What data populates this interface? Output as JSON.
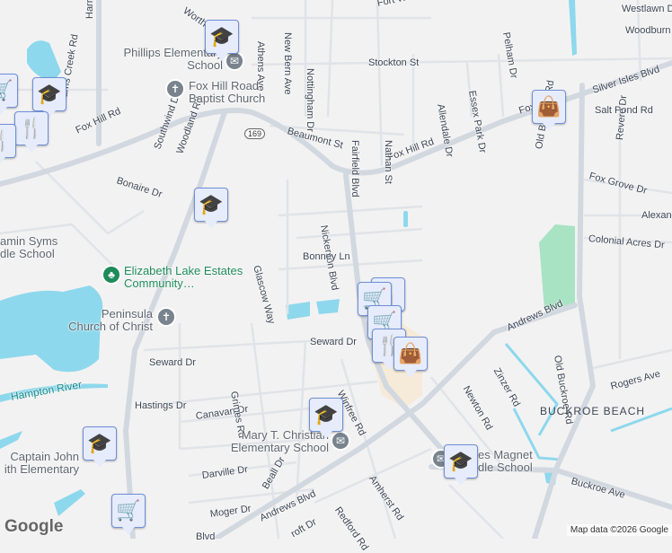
{
  "colors": {
    "background": "#f3f2f3",
    "road": "#d2d8df",
    "water": "#8dd8ec",
    "park": "#a8e3c4",
    "commercial": "#f6ead8",
    "pin_fill": "#e6ecfb",
    "pin_icon": "#0f4a6e"
  },
  "roads": {
    "fox_hill_rd": "Fox Hill Rd",
    "fox_hill_rd_2": "Fox Hill Rd",
    "fox_hill_rd_3": "Fox Hill Rd",
    "fox_hill_rd_4": "Fox Hill Rd",
    "silver_isles": "Silver Isles Blvd",
    "nickerson": "Nickerson Blvd",
    "andrews": "Andrews Blvd",
    "andrews_2": "Andrews Blvd",
    "andrews_3": "Blvd",
    "old_buckroe": "Old Buckroe Rd",
    "old_buckroe_2": "Old Buckroe Rd",
    "buckroe_ave": "Buckroe Ave",
    "woodland": "Woodland Rd",
    "harris_creek": "Harris Creek Rd",
    "harris_c": "Harris C",
    "southwind": "Southwind Dr",
    "bonaire": "Bonaire Dr",
    "beaumont": "Beaumont St",
    "stockton": "Stockton St",
    "athens": "Athens Ave",
    "new_bern": "New Bern Ave",
    "nottingham": "Nottingham Dr",
    "fort_worth": "Fort Worth",
    "worth": "Worth S",
    "fairfield": "Fairfield Blvd",
    "nathan": "Nathan St",
    "allendale": "Allendale Dr",
    "essex": "Essex Park Dr",
    "pelham": "Pelham Dr",
    "westlawn": "Westlawn D",
    "woodburn": "Woodburn",
    "salt_pond": "Salt Pond Rd",
    "revere": "Revere Dr",
    "fox_grove": "Fox Grove Dr",
    "alexan": "Alexan",
    "colonial": "Colonial Acres Dr",
    "glascow": "Glascow Way",
    "bonney": "Bonney Ln",
    "seward": "Seward Dr",
    "seward_2": "Seward Dr",
    "hastings": "Hastings Dr",
    "canavan": "Canavan Dr",
    "grimes": "Grimes Rd",
    "winfree": "Winfree Rd",
    "darville": "Darville Dr",
    "beall": "Beall Dr",
    "moger": "Moger Dr",
    "redford": "Redford Rd",
    "amherst": "Amherst Rd",
    "newton": "Newton Rd",
    "zinzer": "Zinzer Rd",
    "rogers": "Rogers Ave",
    "croft": "roft Dr",
    "route": "169"
  },
  "water_labels": {
    "hampton_river": "Hampton River"
  },
  "area": "BUCKROE BEACH",
  "pois": {
    "phillips": "Phillips Elementary School",
    "fox_hill_church": "Fox Hill Road Baptist Church",
    "elizabeth_lake": "Elizabeth Lake Estates Community…",
    "peninsula": "Peninsula Church of Christ",
    "syms": "amin Syms\ndle School",
    "captain_john": "Captain John\nith Elementary",
    "mary_christian": "Mary T. Christian Elementary School",
    "magnet": "es Magnet\ndle School"
  },
  "attribution": {
    "logo": "Google",
    "text": "Map data ©2026 Google"
  }
}
